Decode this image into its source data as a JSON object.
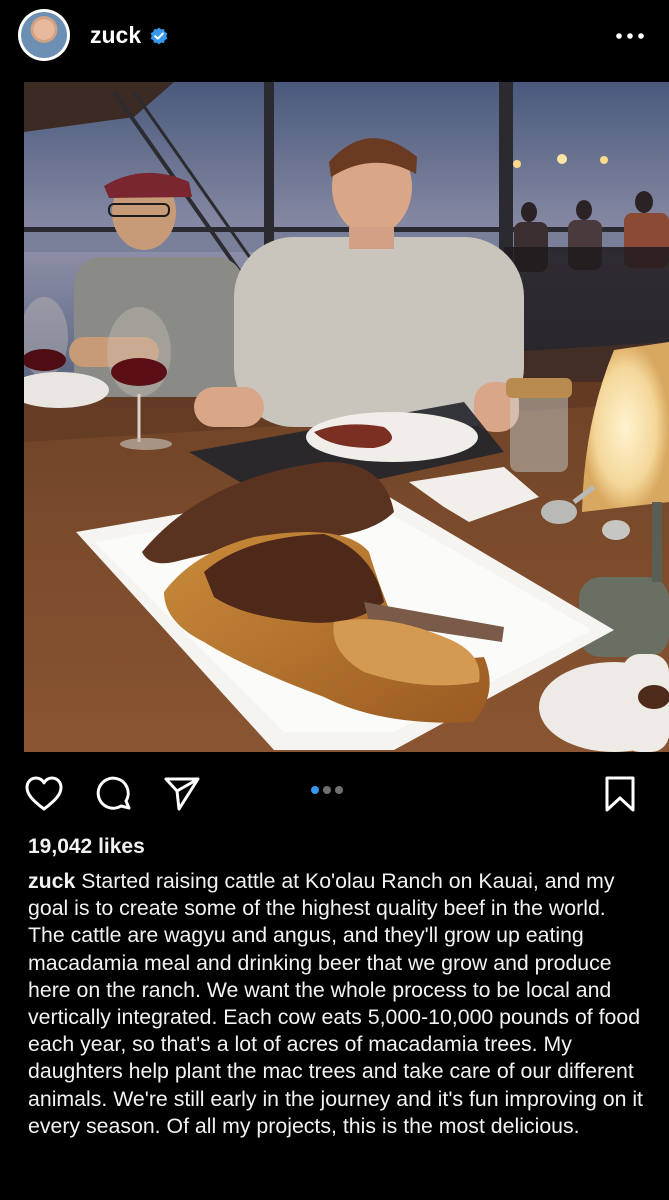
{
  "post": {
    "username": "zuck",
    "likes": "19,042 likes",
    "caption": "Started raising cattle at Ko'olau Ranch on Kauai, and my goal is to create some of the highest quality beef in the world. The cattle are wagyu and angus, and they'll grow up eating macadamia meal and drinking beer that we grow and produce here on the ranch. We want the whole process to be local and vertically integrated. Each cow eats 5,000-10,000 pounds of food each year, so that's a lot of acres of macadamia trees. My daughters help plant the mac trees and take care of our different animals. We're still early in the journey and it's fun improving on it every season. Of all my projects, this is the most delicious.",
    "carousel": {
      "count": 3,
      "active_index": 0
    }
  },
  "colors": {
    "background": "#000000",
    "text": "#f2f2f2",
    "verified_badge": "#3797f0",
    "carousel_active_dot": "#3797f0",
    "carousel_inactive_dot": "#6f6f6f"
  },
  "icons": {
    "avatar": "avatar",
    "verified": "verified-badge-icon",
    "more": "more-options-icon",
    "like": "heart-icon",
    "comment": "comment-icon",
    "share": "send-icon",
    "save": "bookmark-icon"
  }
}
